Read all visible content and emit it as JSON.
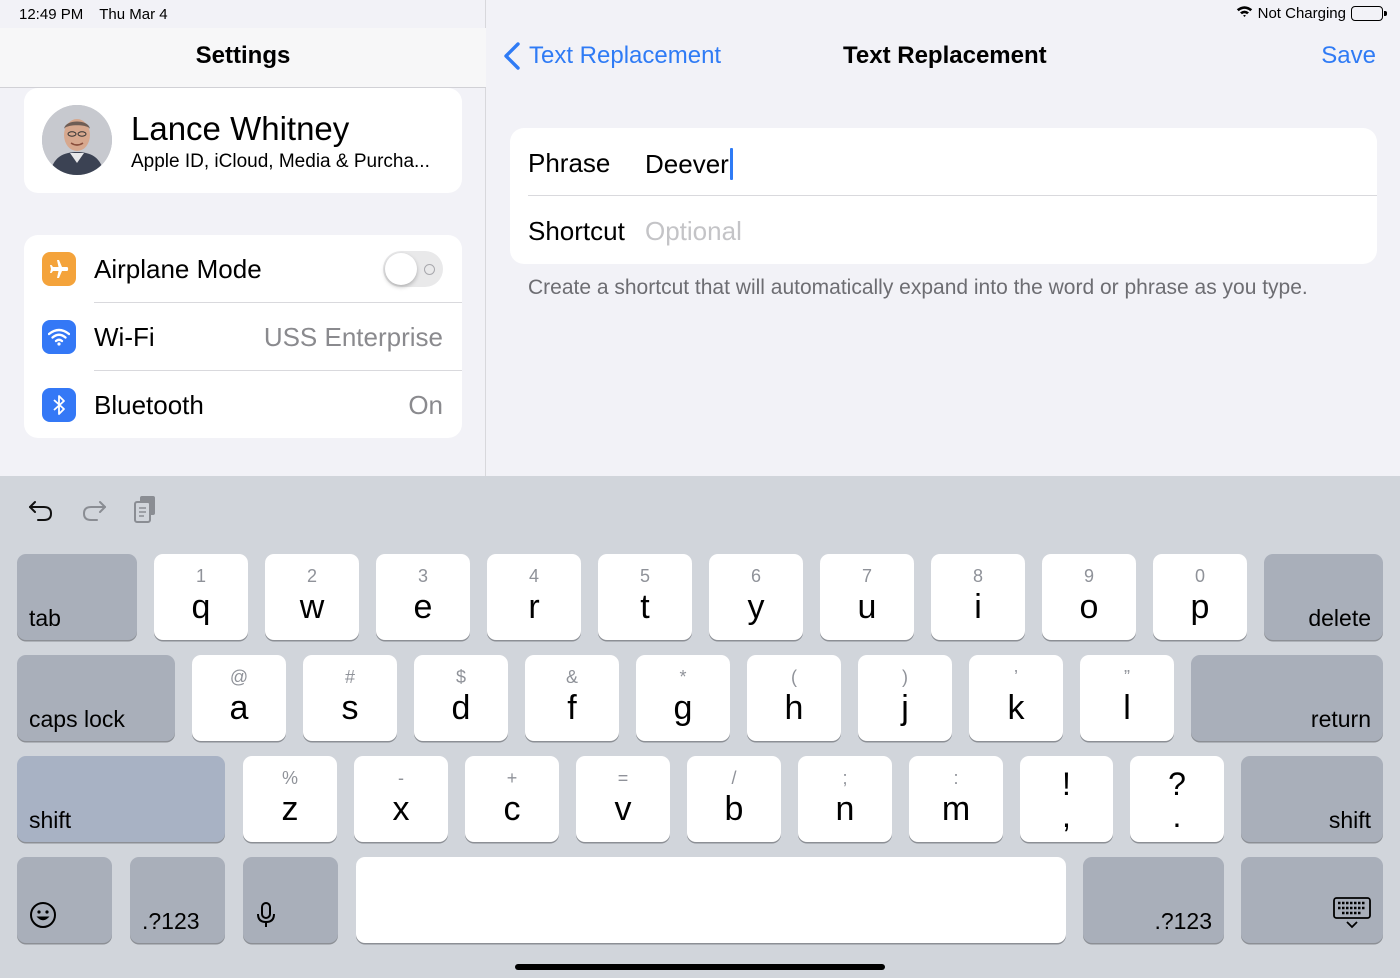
{
  "status_bar": {
    "time": "12:49 PM",
    "date": "Thu Mar 4",
    "battery_status": "Not Charging",
    "battery_level_fraction": 0.65
  },
  "left": {
    "title": "Settings",
    "profile": {
      "name": "Lance Whitney",
      "subtitle": "Apple ID, iCloud, Media & Purcha..."
    },
    "items": [
      {
        "label": "Airplane Mode",
        "icon": "airplane-icon",
        "icon_color": "#f4a33b",
        "toggle_on": false
      },
      {
        "label": "Wi-Fi",
        "value": "USS Enterprise",
        "icon": "wifi-icon",
        "icon_color": "#3478f6"
      },
      {
        "label": "Bluetooth",
        "value": "On",
        "icon": "bluetooth-icon",
        "icon_color": "#3478f6"
      }
    ]
  },
  "right": {
    "back_label": "Text Replacement",
    "title": "Text Replacement",
    "save_label": "Save",
    "phrase_label": "Phrase",
    "phrase_value": "Deever",
    "shortcut_label": "Shortcut",
    "shortcut_placeholder": "Optional",
    "footnote": "Create a shortcut that will automatically expand into the word or phrase as you type."
  },
  "keyboard": {
    "toolbar": [
      "undo-icon",
      "redo-icon",
      "paste-icon"
    ],
    "row1": {
      "tab": "tab",
      "delete": "delete",
      "keys": [
        {
          "p": "q",
          "s": "1"
        },
        {
          "p": "w",
          "s": "2"
        },
        {
          "p": "e",
          "s": "3"
        },
        {
          "p": "r",
          "s": "4"
        },
        {
          "p": "t",
          "s": "5"
        },
        {
          "p": "y",
          "s": "6"
        },
        {
          "p": "u",
          "s": "7"
        },
        {
          "p": "i",
          "s": "8"
        },
        {
          "p": "o",
          "s": "9"
        },
        {
          "p": "p",
          "s": "0"
        }
      ]
    },
    "row2": {
      "caps": "caps lock",
      "return": "return",
      "keys": [
        {
          "p": "a",
          "s": "@"
        },
        {
          "p": "s",
          "s": "#"
        },
        {
          "p": "d",
          "s": "$"
        },
        {
          "p": "f",
          "s": "&"
        },
        {
          "p": "g",
          "s": "*"
        },
        {
          "p": "h",
          "s": "("
        },
        {
          "p": "j",
          "s": ")"
        },
        {
          "p": "k",
          "s": "’"
        },
        {
          "p": "l",
          "s": "”"
        }
      ]
    },
    "row3": {
      "shift_left": "shift",
      "shift_right": "shift",
      "keys": [
        {
          "p": "z",
          "s": "%"
        },
        {
          "p": "x",
          "s": "-"
        },
        {
          "p": "c",
          "s": "+"
        },
        {
          "p": "v",
          "s": "="
        },
        {
          "p": "b",
          "s": "/"
        },
        {
          "p": "n",
          "s": ";"
        },
        {
          "p": "m",
          "s": ":"
        }
      ],
      "punct": [
        {
          "top": "!",
          "bottom": ","
        },
        {
          "top": "?",
          "bottom": "."
        }
      ]
    },
    "row4": {
      "numbers_left": ".?123",
      "numbers_right": ".?123"
    }
  }
}
